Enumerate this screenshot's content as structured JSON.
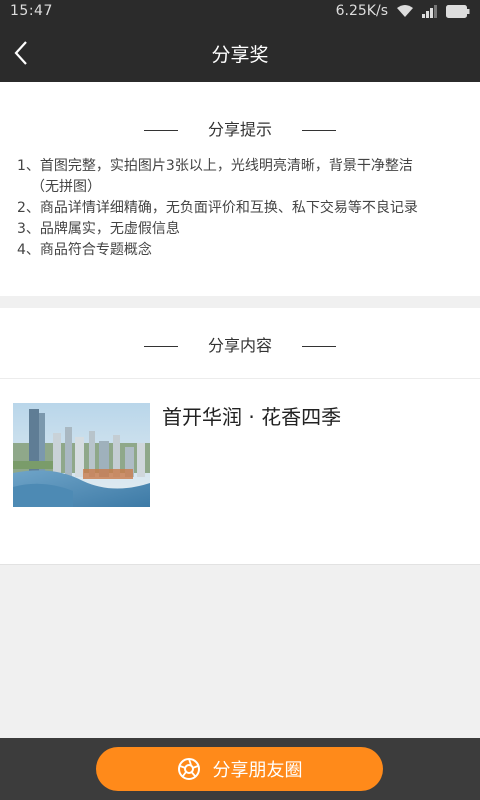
{
  "status_bar": {
    "time": "15:47",
    "network_speed": "6.25K/s"
  },
  "header": {
    "title": "分享奖"
  },
  "tips": {
    "section_title": "分享提示",
    "items": [
      "1、首图完整，实拍图片3张以上，光线明亮清晰，背景干净整洁",
      "（无拼图）",
      "2、商品详情详细精确，无负面评价和互换、私下交易等不良记录",
      "3、品牌属实，无虚假信息",
      "4、商品符合专题概念"
    ]
  },
  "share_content": {
    "section_title": "分享内容",
    "product_name": "首开华润 · 花香四季"
  },
  "footer": {
    "share_button_label": "分享朋友圈"
  },
  "colors": {
    "accent": "#ff8a1a",
    "header_bg": "#2b2b2b",
    "footer_bg": "#3c3c3c"
  }
}
